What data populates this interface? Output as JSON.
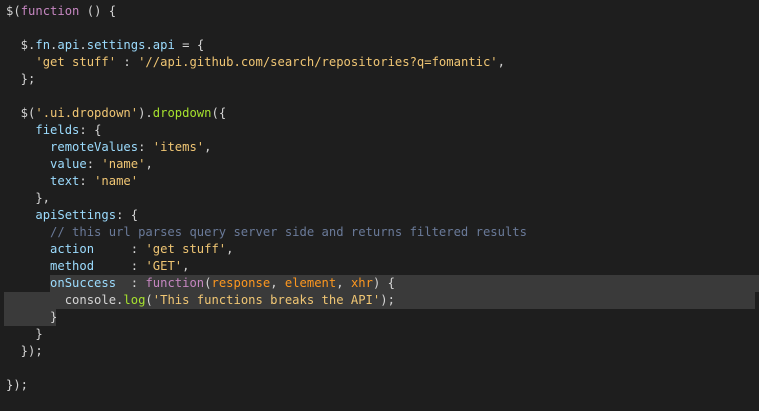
{
  "code_lines": [
    {
      "tokens": [
        [
          "$(",
          "plain"
        ],
        [
          "function",
          "kw"
        ],
        [
          " () {",
          "plain"
        ]
      ]
    },
    {
      "tokens": []
    },
    {
      "tokens": [
        [
          "  $.",
          "plain"
        ],
        [
          "fn",
          "prop"
        ],
        [
          ".",
          "plain"
        ],
        [
          "api",
          "prop"
        ],
        [
          ".",
          "plain"
        ],
        [
          "settings",
          "prop"
        ],
        [
          ".",
          "plain"
        ],
        [
          "api",
          "prop"
        ],
        [
          " = {",
          "plain"
        ]
      ]
    },
    {
      "tokens": [
        [
          "    ",
          "plain"
        ],
        [
          "'get stuff'",
          "str"
        ],
        [
          " : ",
          "plain"
        ],
        [
          "'//api.github.com/search/repositories?q=fomantic'",
          "str"
        ],
        [
          ",",
          "plain"
        ]
      ]
    },
    {
      "tokens": [
        [
          "  };",
          "plain"
        ]
      ]
    },
    {
      "tokens": []
    },
    {
      "tokens": [
        [
          "  $(",
          "plain"
        ],
        [
          "'.ui.dropdown'",
          "str"
        ],
        [
          ").",
          "plain"
        ],
        [
          "dropdown",
          "method"
        ],
        [
          "({",
          "plain"
        ]
      ]
    },
    {
      "tokens": [
        [
          "    ",
          "plain"
        ],
        [
          "fields",
          "prop"
        ],
        [
          ": {",
          "plain"
        ]
      ]
    },
    {
      "tokens": [
        [
          "      ",
          "plain"
        ],
        [
          "remoteValues",
          "prop"
        ],
        [
          ": ",
          "plain"
        ],
        [
          "'items'",
          "str"
        ],
        [
          ",",
          "plain"
        ]
      ]
    },
    {
      "tokens": [
        [
          "      ",
          "plain"
        ],
        [
          "value",
          "prop"
        ],
        [
          ": ",
          "plain"
        ],
        [
          "'name'",
          "str"
        ],
        [
          ",",
          "plain"
        ]
      ]
    },
    {
      "tokens": [
        [
          "      ",
          "plain"
        ],
        [
          "text",
          "prop"
        ],
        [
          ": ",
          "plain"
        ],
        [
          "'name'",
          "str"
        ]
      ]
    },
    {
      "tokens": [
        [
          "    },",
          "plain"
        ]
      ]
    },
    {
      "tokens": [
        [
          "    ",
          "plain"
        ],
        [
          "apiSettings",
          "prop"
        ],
        [
          ": {",
          "plain"
        ]
      ]
    },
    {
      "tokens": [
        [
          "      ",
          "plain"
        ],
        [
          "// this url parses query server side and returns filtered results",
          "cm"
        ]
      ]
    },
    {
      "tokens": [
        [
          "      ",
          "plain"
        ],
        [
          "action",
          "prop"
        ],
        [
          "     : ",
          "plain"
        ],
        [
          "'get stuff'",
          "str"
        ],
        [
          ",",
          "plain"
        ]
      ]
    },
    {
      "tokens": [
        [
          "      ",
          "plain"
        ],
        [
          "method",
          "prop"
        ],
        [
          "     : ",
          "plain"
        ],
        [
          "'GET'",
          "str"
        ],
        [
          ",",
          "plain"
        ]
      ]
    },
    {
      "tokens": [
        [
          "      ",
          "plain"
        ],
        [
          "onSuccess",
          "prop"
        ],
        [
          "  : ",
          "plain"
        ],
        [
          "function",
          "kw"
        ],
        [
          "(",
          "plain"
        ],
        [
          "response",
          "param"
        ],
        [
          ", ",
          "plain"
        ],
        [
          "element",
          "param"
        ],
        [
          ", ",
          "plain"
        ],
        [
          "xhr",
          "param"
        ],
        [
          ") {",
          "plain"
        ]
      ],
      "highlight": "from-indent"
    },
    {
      "tokens": [
        [
          "        console.",
          "plain"
        ],
        [
          "log",
          "method"
        ],
        [
          "(",
          "plain"
        ],
        [
          "'This functions breaks the API'",
          "str"
        ],
        [
          ");",
          "plain"
        ]
      ],
      "highlight": "full"
    },
    {
      "tokens": [
        [
          "      }",
          "plain"
        ]
      ],
      "highlight": "full-short"
    },
    {
      "tokens": [
        [
          "    }",
          "plain"
        ]
      ]
    },
    {
      "tokens": [
        [
          "  });",
          "plain"
        ]
      ]
    },
    {
      "tokens": []
    },
    {
      "tokens": [
        [
          "});",
          "plain"
        ]
      ]
    }
  ],
  "colors": {
    "background": "#1e1e1e",
    "highlight": "#3a3a3a",
    "plain": "#d4d4d4",
    "keyword": "#c586c0",
    "property": "#9cdcfe",
    "string": "#f0c674",
    "comment": "#6a7a99",
    "param": "#fd971f",
    "method": "#a6e22e"
  }
}
